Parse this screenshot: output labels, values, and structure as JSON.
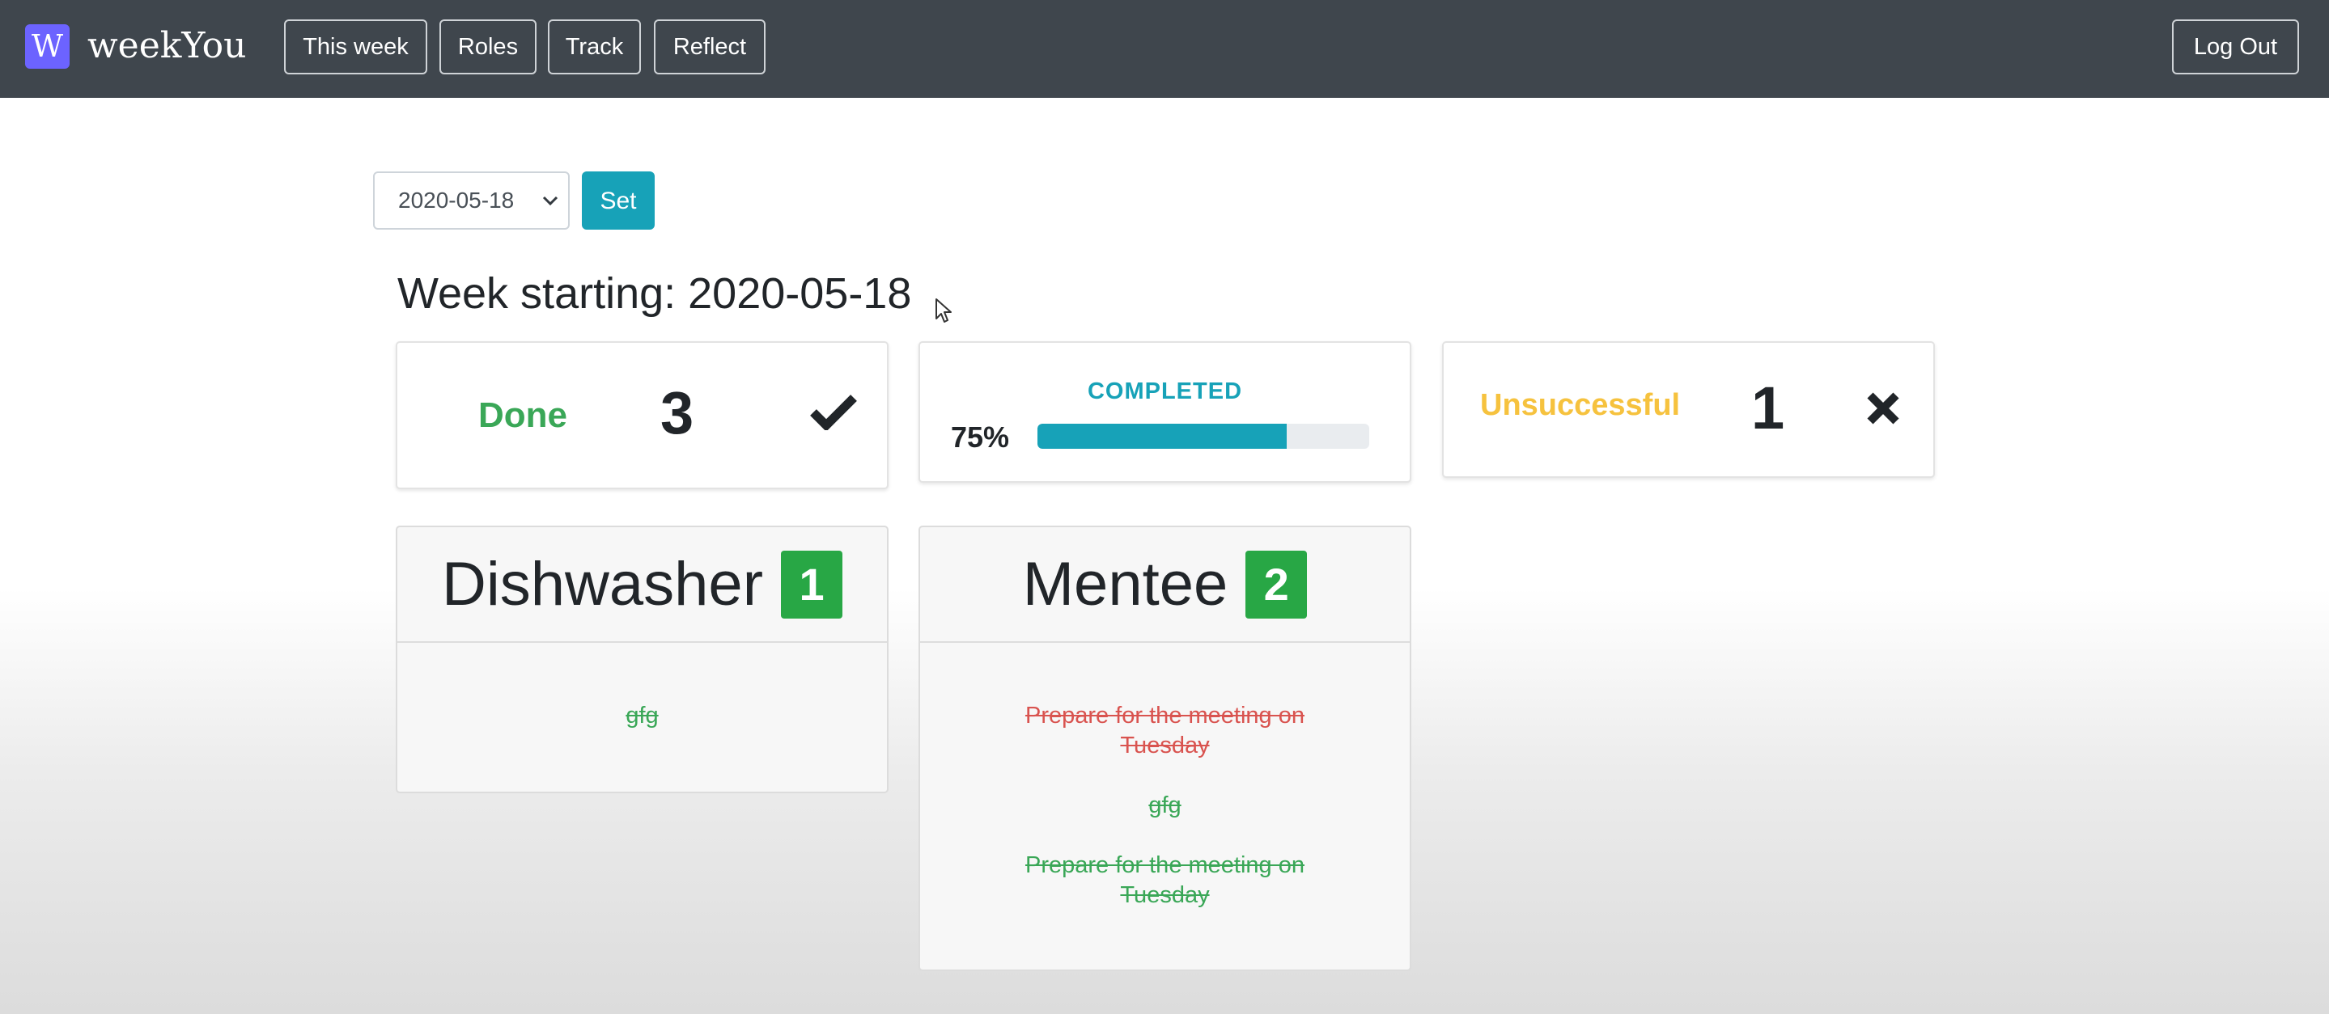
{
  "brand": {
    "logo_letter": "W",
    "name": "weekYou",
    "color": "#6c63ff"
  },
  "nav": {
    "this_week": "This week",
    "roles": "Roles",
    "track": "Track",
    "reflect": "Reflect",
    "logout": "Log Out"
  },
  "week_select": {
    "selected": "2020-05-18",
    "set_label": "Set"
  },
  "week_title": "Week starting: 2020-05-18",
  "stats": {
    "done": {
      "label": "Done",
      "count": "3",
      "icon": "check-icon",
      "color": "#3aa757"
    },
    "completed": {
      "label": "COMPLETED",
      "percent_text": "75%",
      "fraction": 0.75,
      "color": "#17a2b8"
    },
    "unsuccessful": {
      "label": "Unsuccessful",
      "count": "1",
      "icon": "x-icon",
      "color": "#f6c23e"
    }
  },
  "roles": [
    {
      "name": "Dishwasher",
      "count": "1",
      "tasks": [
        {
          "text": "gfg",
          "status": "done"
        }
      ]
    },
    {
      "name": "Mentee",
      "count": "2",
      "tasks": [
        {
          "text": "Prepare for the meeting on Tuesday",
          "status": "unsuccessful"
        },
        {
          "text": "gfg",
          "status": "done"
        },
        {
          "text": "Prepare for the meeting on Tuesday",
          "status": "done"
        }
      ]
    }
  ],
  "colors": {
    "navbar": "#3f464d",
    "success": "#28a745",
    "danger": "#d9534f",
    "info": "#17a2b8"
  }
}
